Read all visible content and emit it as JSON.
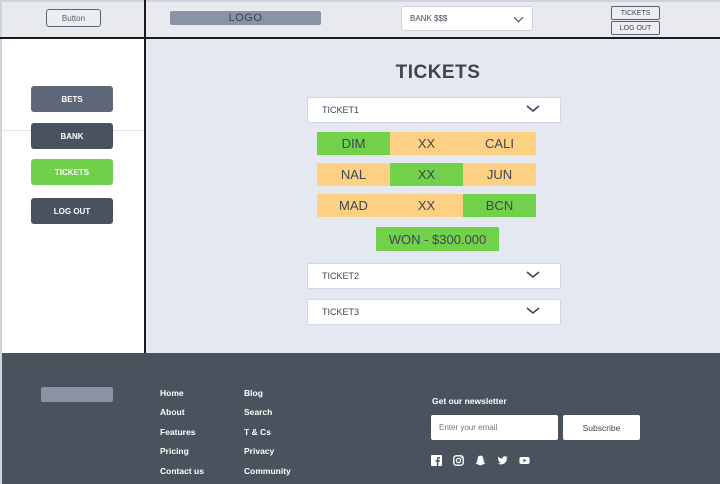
{
  "header": {
    "button_label": "Button",
    "logo_text": "LOGO",
    "bank_select": {
      "selected": "BANK $$$",
      "icon": "chevron-down-icon"
    },
    "tickets_button": "TICKETS",
    "logout_button": "LOG OUT"
  },
  "sidebar": {
    "items": [
      {
        "label": "BETS",
        "active": false
      },
      {
        "label": "BANK",
        "active": false
      },
      {
        "label": "TICKETS",
        "active": true
      },
      {
        "label": "LOG OUT",
        "active": false
      }
    ]
  },
  "main": {
    "title": "TICKETS",
    "tickets": [
      {
        "label": "TICKET1",
        "expanded": true
      },
      {
        "label": "TICKET2",
        "expanded": false
      },
      {
        "label": "TICKET3",
        "expanded": false
      }
    ],
    "grid": [
      [
        {
          "text": "DIM",
          "color": "#71d14b"
        },
        {
          "text": "XX",
          "color": "#fdd084"
        },
        {
          "text": "CALI",
          "color": "#fdd084"
        }
      ],
      [
        {
          "text": "NAL",
          "color": "#fdd084"
        },
        {
          "text": "XX",
          "color": "#71d14b"
        },
        {
          "text": "JUN",
          "color": "#fdd084"
        }
      ],
      [
        {
          "text": "MAD",
          "color": "#fdd084"
        },
        {
          "text": "XX",
          "color": "#fdd084"
        },
        {
          "text": "BCN",
          "color": "#71d14b"
        }
      ]
    ],
    "result": "WON - $300.000"
  },
  "footer": {
    "links_col1": [
      "Home",
      "About",
      "Features",
      "Pricing",
      "Contact us"
    ],
    "links_col2": [
      "Blog",
      "Search",
      "T & Cs",
      "Privacy",
      "Community"
    ],
    "newsletter_title": "Get our newsletter",
    "email_placeholder": "Enter your email",
    "subscribe_label": "Subscribe",
    "social_icons": [
      "facebook-icon",
      "instagram-icon",
      "snapchat-icon",
      "twitter-icon",
      "youtube-icon"
    ]
  },
  "colors": {
    "green": "#71d14b",
    "orange": "#fdd084",
    "dark": "#4a525e",
    "main_bg": "#e4e8f1"
  }
}
